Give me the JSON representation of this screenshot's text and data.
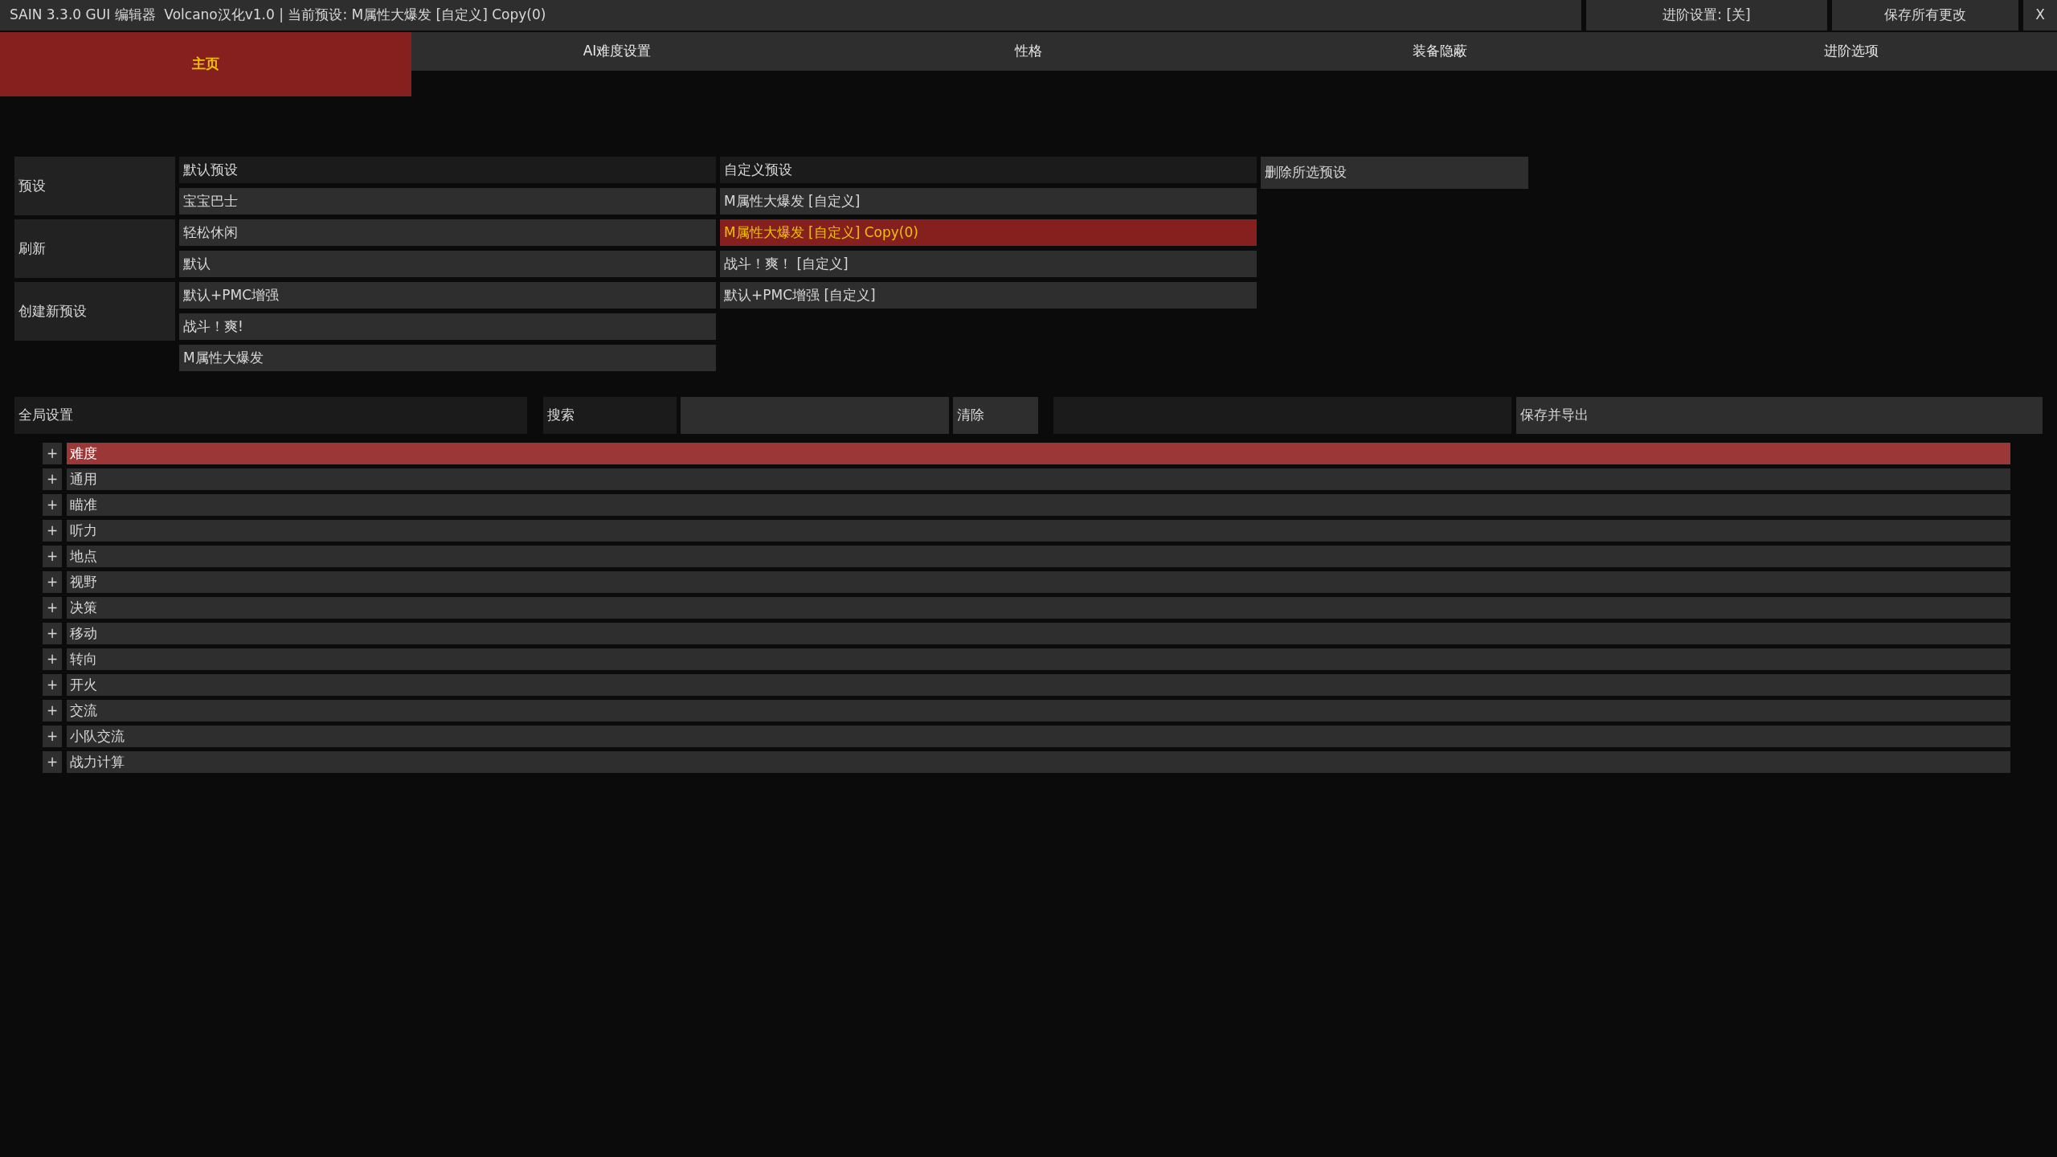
{
  "title_bar": {
    "title": "SAIN 3.3.0 GUI 编辑器  Volcano汉化v1.0 | 当前预设: M属性大爆发 [自定义] Copy(0)",
    "buttons": [
      "进阶设置: [关]",
      "保存所有更改"
    ],
    "close": "X"
  },
  "tabs": [
    {
      "label": "主页",
      "selected": true
    },
    {
      "label": "AI难度设置",
      "selected": false
    },
    {
      "label": "性格",
      "selected": false
    },
    {
      "label": "装备隐蔽",
      "selected": false
    },
    {
      "label": "进阶选项",
      "selected": false
    }
  ],
  "presets": {
    "side_buttons": [
      "预设",
      "刷新",
      "创建新预设"
    ],
    "default_presets": {
      "header": "默认预设",
      "items": [
        {
          "label": "宝宝巴士",
          "selected": false
        },
        {
          "label": "轻松休闲",
          "selected": false
        },
        {
          "label": "默认",
          "selected": false
        },
        {
          "label": "默认+PMC增强",
          "selected": false
        },
        {
          "label": "战斗！爽!",
          "selected": false
        },
        {
          "label": "M属性大爆发",
          "selected": false
        }
      ]
    },
    "custom_presets": {
      "header": "自定义预设",
      "items": [
        {
          "label": "M属性大爆发 [自定义]",
          "selected": false
        },
        {
          "label": "M属性大爆发 [自定义] Copy(0)",
          "selected": true
        },
        {
          "label": "战斗！爽！ [自定义]",
          "selected": false
        },
        {
          "label": "默认+PMC增强 [自定义]",
          "selected": false
        }
      ]
    },
    "delete_button": "删除所选预设"
  },
  "toolbar": {
    "global_settings": "全局设置",
    "search_label": "搜索",
    "clear_button": "清除",
    "save_export_button": "保存并导出"
  },
  "categories": [
    {
      "label": "难度",
      "toggle": "+",
      "selected": true
    },
    {
      "label": "通用",
      "toggle": "+",
      "selected": false
    },
    {
      "label": "瞄准",
      "toggle": "+",
      "selected": false
    },
    {
      "label": "听力",
      "toggle": "+",
      "selected": false
    },
    {
      "label": "地点",
      "toggle": "+",
      "selected": false
    },
    {
      "label": "视野",
      "toggle": "+",
      "selected": false
    },
    {
      "label": "决策",
      "toggle": "+",
      "selected": false
    },
    {
      "label": "移动",
      "toggle": "+",
      "selected": false
    },
    {
      "label": "转向",
      "toggle": "+",
      "selected": false
    },
    {
      "label": "开火",
      "toggle": "+",
      "selected": false
    },
    {
      "label": "交流",
      "toggle": "+",
      "selected": false
    },
    {
      "label": "小队交流",
      "toggle": "+",
      "selected": false
    },
    {
      "label": "战力计算",
      "toggle": "+",
      "selected": false
    }
  ]
}
